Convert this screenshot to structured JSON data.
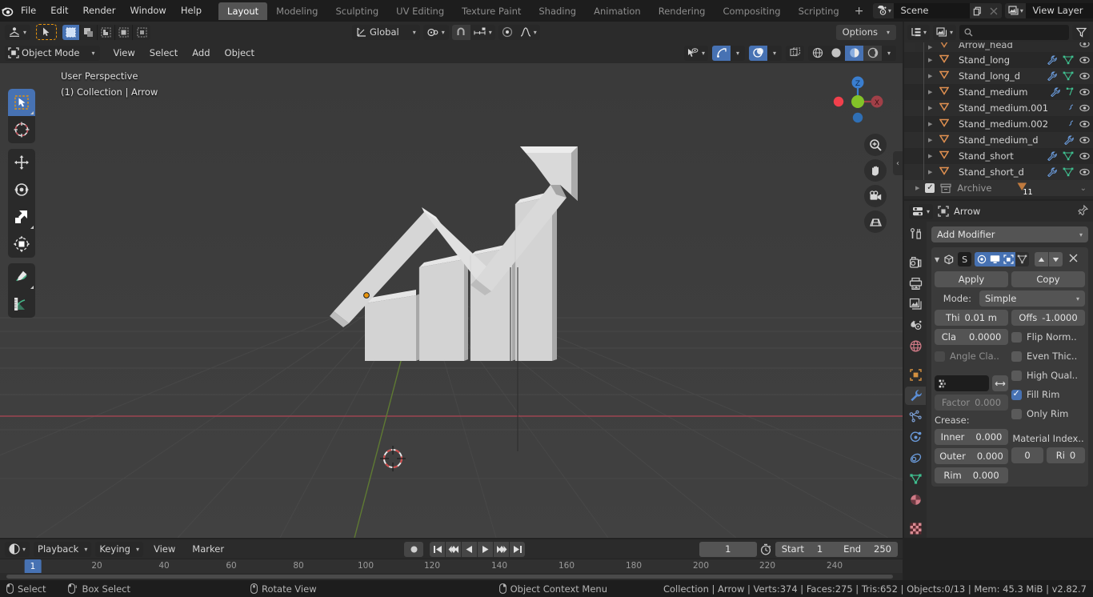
{
  "app": {
    "version": "v2.82.7"
  },
  "topbar": {
    "menus": [
      "File",
      "Edit",
      "Render",
      "Window",
      "Help"
    ],
    "workspaces": [
      {
        "label": "Layout",
        "active": true
      },
      {
        "label": "Modeling",
        "active": false
      },
      {
        "label": "Sculpting",
        "active": false
      },
      {
        "label": "UV Editing",
        "active": false
      },
      {
        "label": "Texture Paint",
        "active": false
      },
      {
        "label": "Shading",
        "active": false
      },
      {
        "label": "Animation",
        "active": false
      },
      {
        "label": "Rendering",
        "active": false
      },
      {
        "label": "Compositing",
        "active": false
      },
      {
        "label": "Scripting",
        "active": false
      }
    ],
    "add_workspace_label": "+",
    "scene_name": "Scene",
    "view_layer_name": "View Layer"
  },
  "viewport": {
    "header": {
      "editor_type_icon": "editor-type-icon",
      "mode_label": "Object Mode",
      "menus": [
        "View",
        "Select",
        "Add",
        "Object"
      ],
      "transform_orientation": "Global",
      "options_label": "Options",
      "select_modes": [
        "tweak-select",
        "box-select",
        "circle-select",
        "lasso-select"
      ]
    },
    "overlay": {
      "perspective": "User Perspective",
      "collection_info": "(1) Collection | Arrow"
    },
    "gizmo": {
      "axis_z": "Z",
      "axis_x": "X"
    },
    "tools": [
      {
        "name": "tweak-tool",
        "active": true
      },
      {
        "name": "cursor-tool",
        "active": false
      },
      {
        "name": "move-tool",
        "active": false
      },
      {
        "name": "rotate-tool",
        "active": false
      },
      {
        "name": "scale-tool",
        "active": false
      },
      {
        "name": "transform-tool",
        "active": false
      },
      {
        "name": "annotate-tool",
        "active": false
      },
      {
        "name": "measure-tool",
        "active": false
      }
    ]
  },
  "outliner": {
    "search_placeholder": "",
    "items": [
      {
        "name": "Arrow_head",
        "partial": true
      },
      {
        "name": "Stand_long",
        "partial": false
      },
      {
        "name": "Stand_long_d",
        "partial": false
      },
      {
        "name": "Stand_medium",
        "partial": false
      },
      {
        "name": "Stand_medium.001",
        "partial": false
      },
      {
        "name": "Stand_medium.002",
        "partial": false
      },
      {
        "name": "Stand_medium_d",
        "partial": false
      },
      {
        "name": "Stand_short",
        "partial": false
      },
      {
        "name": "Stand_short_d",
        "partial": false
      }
    ],
    "archive": {
      "label": "Archive",
      "count": "11"
    }
  },
  "properties": {
    "object_name": "Arrow",
    "add_modifier_label": "Add Modifier",
    "modifier": {
      "badge": "S",
      "apply_label": "Apply",
      "copy_label": "Copy",
      "mode_label": "Mode:",
      "mode_value": "Simple",
      "thickness_label": "Thi",
      "thickness_value": "0.01 m",
      "offset_label": "Offs",
      "offset_value": "-1.0000",
      "clamp_label": "Cla",
      "clamp_value": "0.0000",
      "angle_clamp_label": "Angle Cla..",
      "factor_label": "Factor",
      "factor_value": "0.000",
      "crease_label": "Crease:",
      "inner_label": "Inner",
      "inner_value": "0.000",
      "outer_label": "Outer",
      "outer_value": "0.000",
      "rim_label": "Rim",
      "rim_value": "0.000",
      "flip_normals_label": "Flip Norm..",
      "even_thickness_label": "Even Thic..",
      "high_quality_label": "High Qual..",
      "fill_rim_label": "Fill Rim",
      "only_rim_label": "Only Rim",
      "material_index_label": "Material Index..",
      "material_index_value": "0",
      "rim_index_label": "Ri",
      "rim_index_value": "0"
    }
  },
  "timeline": {
    "playback_label": "Playback",
    "keying_label": "Keying",
    "view_label": "View",
    "marker_label": "Marker",
    "current_frame": "1",
    "start_label": "Start",
    "start_value": "1",
    "end_label": "End",
    "end_value": "250",
    "playhead_label": "1",
    "ticks": [
      "20",
      "40",
      "60",
      "80",
      "100",
      "120",
      "140",
      "160",
      "180",
      "200",
      "220",
      "240"
    ]
  },
  "statusbar": {
    "hints": [
      {
        "label": "Select",
        "icon": "mouse-left-icon"
      },
      {
        "label": "Box Select",
        "icon": "mouse-left-drag-icon"
      },
      {
        "label": "Rotate View",
        "icon": "mouse-middle-icon"
      },
      {
        "label": "Object Context Menu",
        "icon": "mouse-right-icon"
      }
    ],
    "scene_stats": "Collection | Arrow | Verts:374 | Faces:275 | Tris:652 | Objects:0/13 | Mem: 45.3 MiB | v2.82.7"
  },
  "colors": {
    "accent_blue": "#4772b3",
    "orange": "#e8940b",
    "axis_x": "#cf3a4a",
    "axis_z": "#3a7ecf",
    "axis_y": "#7ac33a",
    "mesh_icon": "#e09050",
    "wrench_blue": "#6a9ad9",
    "data_green": "#3fbf8f"
  }
}
